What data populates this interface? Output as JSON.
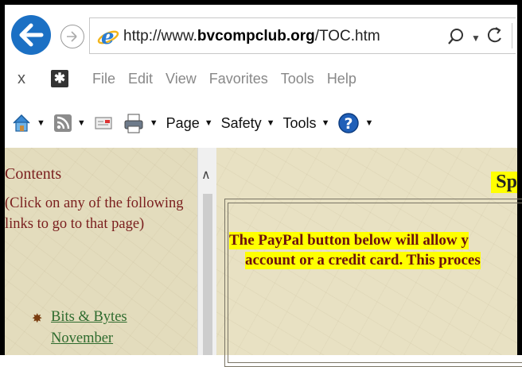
{
  "browser": {
    "url_prefix": "http://www.",
    "url_domain": "bvcompclub.org",
    "url_path": "/TOC.htm",
    "menu_close": "x",
    "menu_items": [
      "File",
      "Edit",
      "View",
      "Favorites",
      "Tools",
      "Help"
    ],
    "command_bar": {
      "page_label": "Page",
      "safety_label": "Safety",
      "tools_label": "Tools"
    }
  },
  "sidebar": {
    "title": "Contents",
    "instructions": "(Click on any of the following links to go to that page)",
    "links": [
      "Bits & Bytes",
      "November"
    ]
  },
  "main": {
    "heading": "Sp",
    "paypal_line1": "The PayPal button below will allow y",
    "paypal_line2": "account or a credit card.  This proces"
  },
  "colors": {
    "accent": "#1b70c4",
    "highlight": "#ffff00",
    "sidebar_text": "#7a1e1e",
    "link": "#2e6b2e"
  }
}
